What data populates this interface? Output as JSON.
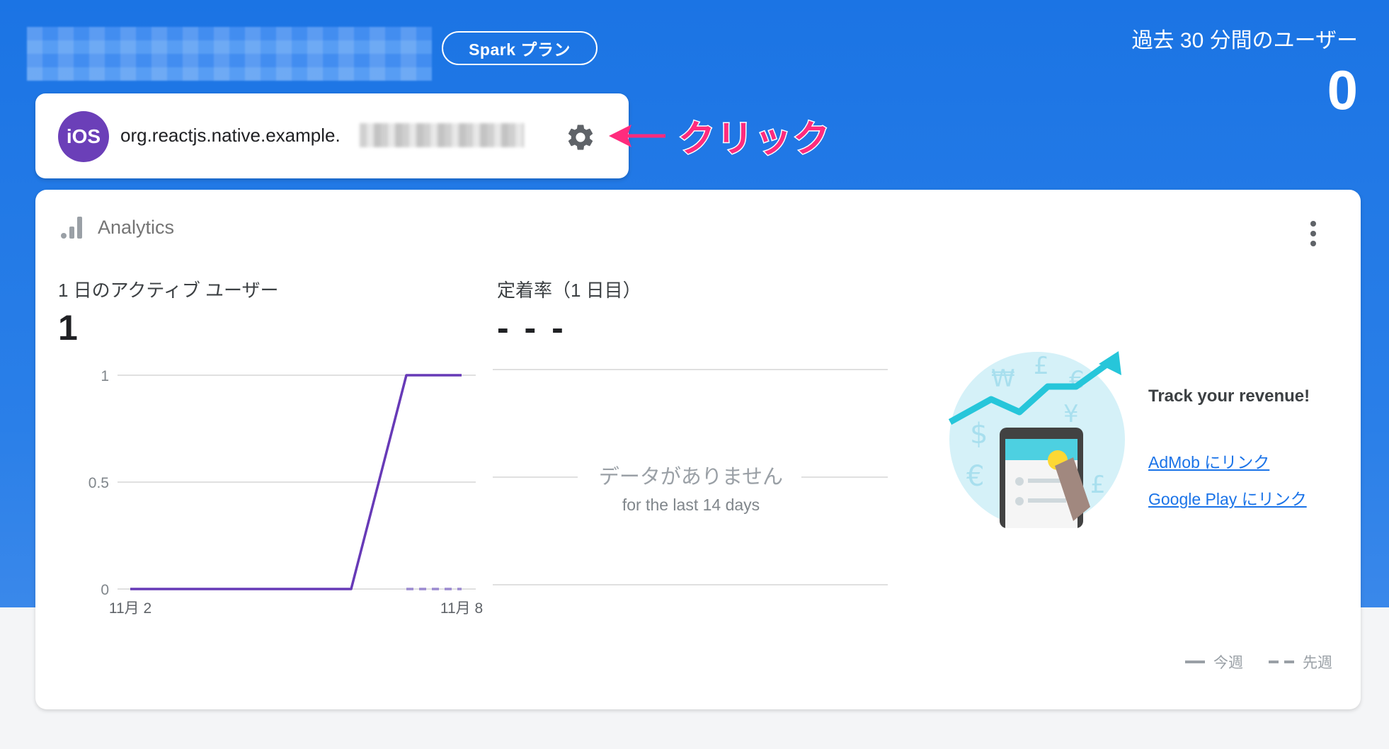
{
  "header": {
    "plan_badge": "Spark プラン",
    "realtime_label": "過去 30 分間のユーザー",
    "realtime_value": "0"
  },
  "app_card": {
    "platform_badge": "iOS",
    "bundle_id_visible": "org.reactjs.native.example."
  },
  "annotation": {
    "text": "クリック",
    "color": "#ff2b7d"
  },
  "analytics": {
    "title": "Analytics",
    "metrics": [
      {
        "label": "1 日のアクティブ ユーザー",
        "value": "1"
      },
      {
        "label": "定着率（1 日目）",
        "value": "- - -"
      }
    ],
    "no_data": "データがありません",
    "no_data_sub": "for the last 14 days",
    "promo": {
      "title": "Track your revenue!",
      "links": [
        "AdMob にリンク",
        "Google Play にリンク"
      ]
    },
    "legend": {
      "this_week": "今週",
      "last_week": "先週"
    }
  },
  "chart_data": {
    "type": "line",
    "x_labels": [
      "11月 2",
      "11月 8"
    ],
    "ylim": [
      0,
      1
    ],
    "y_ticks": [
      "0",
      "0.5",
      "1"
    ],
    "x_points": 7,
    "series": [
      {
        "name": "今週",
        "values": [
          0,
          0,
          0,
          0,
          0,
          1,
          1
        ],
        "style": "solid",
        "color": "#673ab7"
      },
      {
        "name": "先週",
        "values": [
          null,
          null,
          null,
          null,
          null,
          0,
          0
        ],
        "style": "dashed",
        "color": "#9b8ad0"
      }
    ]
  },
  "colors": {
    "brand_blue": "#1b74e4",
    "ios_badge": "#6b3fb8",
    "link": "#1a73e8"
  }
}
